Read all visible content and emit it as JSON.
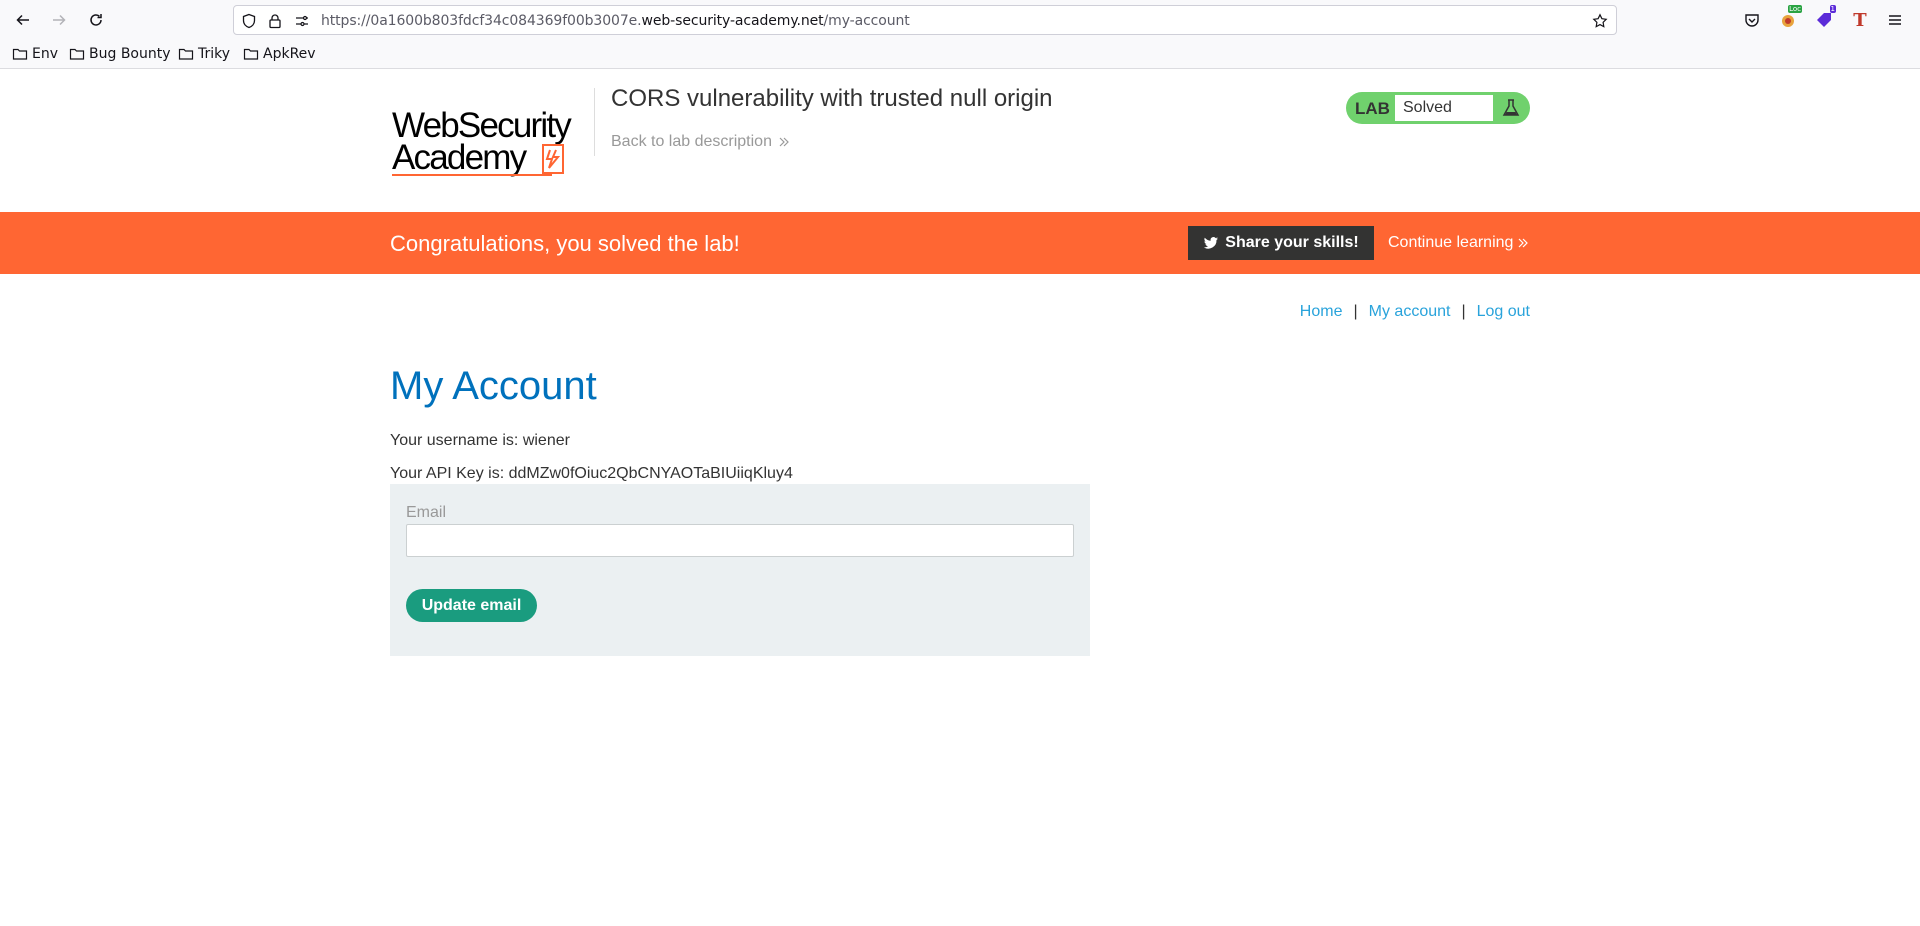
{
  "browser": {
    "url_prefix": "https://0a1600b803fdcf34c084369f00b3007e.",
    "url_domain": "web-security-academy.net",
    "url_path": "/my-account",
    "extensions": {
      "loc_badge": "Loc",
      "count_badge": "1",
      "t_icon": "T"
    },
    "bookmarks": [
      {
        "label": "Env"
      },
      {
        "label": "Bug Bounty"
      },
      {
        "label": "Triky"
      },
      {
        "label": "ApkRev"
      }
    ]
  },
  "header": {
    "logo_line1": "WebSecurity",
    "logo_line2": "Academy",
    "lab_title": "CORS vulnerability with trusted null origin",
    "back_link": "Back to lab description",
    "lab_label": "LAB",
    "lab_status": "Solved"
  },
  "banner": {
    "message": "Congratulations, you solved the lab!",
    "share_button": "Share your skills!",
    "continue_link": "Continue learning"
  },
  "nav": {
    "home": "Home",
    "my_account": "My account",
    "log_out": "Log out",
    "separator": "|"
  },
  "main": {
    "title": "My Account",
    "username_line": "Your username is: wiener",
    "apikey_line": "Your API Key is: ddMZw0fOiuc2QbCNYAOTaBIUiiqKluy4",
    "email_label": "Email",
    "email_value": "",
    "update_button": "Update email"
  },
  "colors": {
    "banner": "#ff6633",
    "lab_status": "#70d16d",
    "title_blue": "#0071bc",
    "link_blue": "#29a3db",
    "button_green": "#1a9c7f"
  }
}
